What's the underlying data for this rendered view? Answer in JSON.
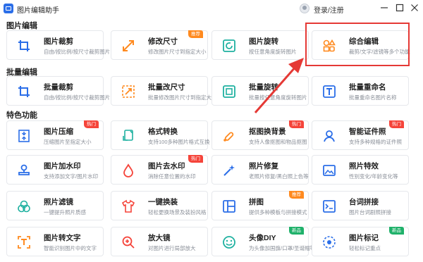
{
  "app": {
    "title": "图片编辑助手",
    "login": "登录/注册"
  },
  "sections": {
    "edit": "图片编辑",
    "batch": "批量编辑",
    "special": "特色功能"
  },
  "colors": {
    "icon": "#2b6ee8",
    "badge_orange": "#ff8a1f",
    "badge_red": "#f5443a",
    "badge_green": "#1fb16a",
    "highlight": "#e53935"
  },
  "cards": {
    "crop": {
      "name": "图片裁剪",
      "desc": "自由/按比例/按尺寸裁剪图片"
    },
    "resize": {
      "name": "修改尺寸",
      "desc": "修改图片尺寸到指定大小",
      "badge": "推荐"
    },
    "rotate": {
      "name": "图片旋转",
      "desc": "按任意角度旋转图片"
    },
    "combo": {
      "name": "综合编辑",
      "desc": "裁剪/文字/滤镜等多个功能"
    },
    "batch_crop": {
      "name": "批量裁剪",
      "desc": "自由/按比例/按尺寸裁剪图片"
    },
    "batch_resize": {
      "name": "批量改尺寸",
      "desc": "批量修改图片尺寸到指定大小"
    },
    "batch_rotate": {
      "name": "批量旋转",
      "desc": "批量按任意角度旋转图片"
    },
    "batch_rename": {
      "name": "批量重命名",
      "desc": "批量重命名图片名称"
    },
    "compress": {
      "name": "图片压缩",
      "desc": "压缩图片至指定大小",
      "badge": "热门"
    },
    "convert": {
      "name": "格式转换",
      "desc": "支持100多种图片格式互换"
    },
    "cutout": {
      "name": "抠图换背景",
      "desc": "支持人像抠图和物品抠图",
      "badge": "热门"
    },
    "idphoto": {
      "name": "智能证件照",
      "desc": "支持多种规格的证件照",
      "badge": "热门"
    },
    "watermark_add": {
      "name": "图片加水印",
      "desc": "支持添加文字/图片水印"
    },
    "watermark_remove": {
      "name": "图片去水印",
      "desc": "消除任意位置的水印",
      "badge": "热门"
    },
    "repair": {
      "name": "照片修复",
      "desc": "老照片修复/黑白照上色等"
    },
    "effects": {
      "name": "照片特效",
      "desc": "性别变化/年龄变化等"
    },
    "filter": {
      "name": "照片滤镜",
      "desc": "一键提升照片质感"
    },
    "outfit": {
      "name": "一键换装",
      "desc": "轻松更换场景及装扮风格"
    },
    "puzzle": {
      "name": "拼图",
      "desc": "提供多种模板与拼接模式",
      "badge": "推荐"
    },
    "lines": {
      "name": "台词拼接",
      "desc": "图片台词剧照拼接"
    },
    "ocr": {
      "name": "图片转文字",
      "desc": "智能识别图片中的文字"
    },
    "magnifier": {
      "name": "放大镜",
      "desc": "对图片进行局部放大"
    },
    "avatar_diy": {
      "name": "头像DIY",
      "desc": "为头像加国旗/口罩/圣诞帽等",
      "badge": "新品"
    },
    "mark": {
      "name": "图片标记",
      "desc": "轻松标记重点",
      "badge": "新品"
    }
  }
}
